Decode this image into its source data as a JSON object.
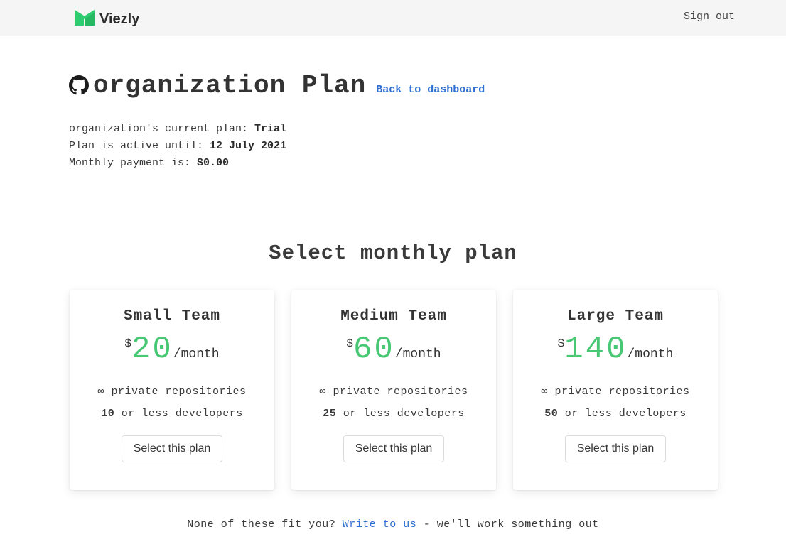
{
  "navbar": {
    "brand_name": "Viezly",
    "sign_out_label": "Sign out",
    "logo_color": "#2ecc71"
  },
  "header": {
    "icon": "github-icon",
    "title": "organization Plan",
    "back_link": "Back to dashboard"
  },
  "plan_info": {
    "current_plan_label": "organization's current plan: ",
    "current_plan_value": "Trial",
    "active_until_label": "Plan is active until: ",
    "active_until_value": "12 July 2021",
    "monthly_payment_label": "Monthly payment is: ",
    "monthly_payment_value": "$0.00"
  },
  "section_title": "Select monthly plan",
  "plans": [
    {
      "name": "Small Team",
      "currency": "$",
      "price": "20",
      "period": "/month",
      "feature1": "∞ private repositories",
      "dev_count": "10",
      "dev_text": " or less developers",
      "button": "Select this plan"
    },
    {
      "name": "Medium Team",
      "currency": "$",
      "price": "60",
      "period": "/month",
      "feature1": "∞ private repositories",
      "dev_count": "25",
      "dev_text": " or less developers",
      "button": "Select this plan"
    },
    {
      "name": "Large Team",
      "currency": "$",
      "price": "140",
      "period": "/month",
      "feature1": "∞ private repositories",
      "dev_count": "50",
      "dev_text": " or less developers",
      "button": "Select this plan"
    }
  ],
  "footer": {
    "prefix": "None of these fit you? ",
    "link": "Write to us",
    "suffix": " - we'll work something out"
  },
  "colors": {
    "accent_green": "#48c774",
    "link_blue": "#2f6fd1"
  }
}
